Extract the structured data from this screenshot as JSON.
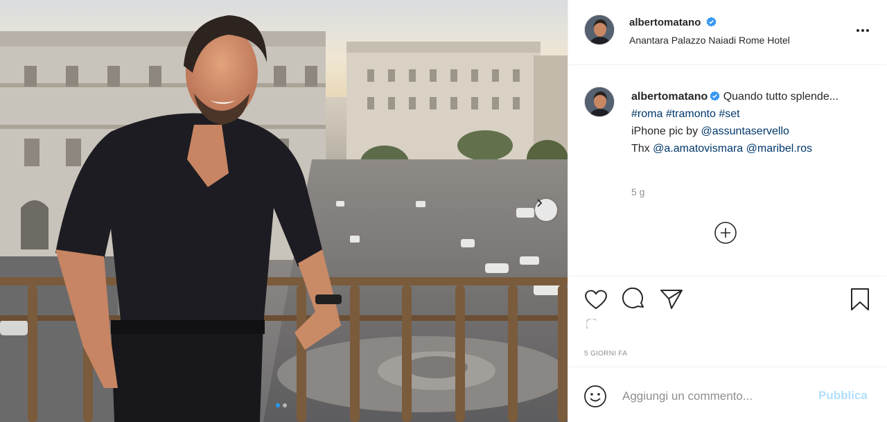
{
  "post": {
    "username": "albertomatano",
    "location": "Anantara Palazzo Naiadi Rome Hotel",
    "caption": {
      "text": "Quando tutto splende...",
      "hashtags": [
        "#roma",
        "#tramonto",
        "#set"
      ],
      "credit_prefix": "iPhone pic by",
      "credit_user": "@assuntaservello",
      "thanks_prefix": "Thx",
      "thanks_users": [
        "@a.amatovismara",
        "@maribel.ros"
      ]
    },
    "time_ago": "5 g",
    "date_label": "5 GIORNI FA",
    "carousel": {
      "slides": 2,
      "active": 1
    }
  },
  "comment": {
    "placeholder": "Aggiungi un commento...",
    "publish_label": "Pubblica"
  },
  "colors": {
    "verified": "#3897f0",
    "link": "#00376b",
    "publish_disabled": "#b2dffc",
    "muted": "#8e8e8e"
  },
  "icons": [
    "more-options-icon",
    "add-circle-icon",
    "heart-icon",
    "comment-icon",
    "share-icon",
    "bookmark-icon",
    "emoji-icon",
    "chevron-right-icon",
    "verified-badge-icon"
  ]
}
